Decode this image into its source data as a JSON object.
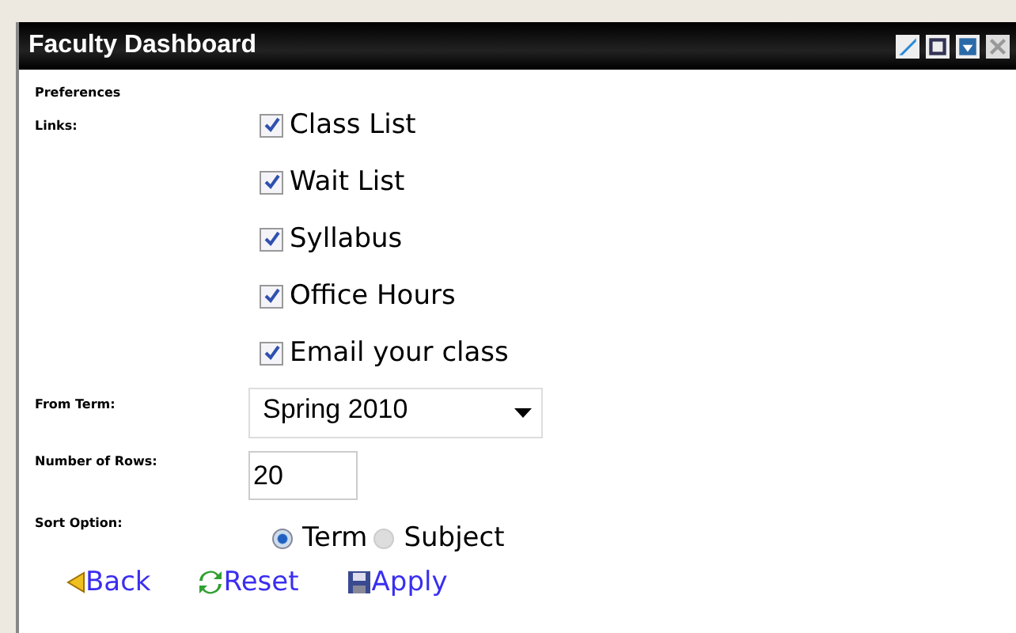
{
  "window": {
    "title": "Faculty Dashboard"
  },
  "section_title": "Preferences",
  "links_label": "Links:",
  "links": [
    {
      "label": "Class List",
      "checked": true
    },
    {
      "label": "Wait List",
      "checked": true
    },
    {
      "label": "Syllabus",
      "checked": true
    },
    {
      "label": "Office Hours",
      "checked": true
    },
    {
      "label": "Email your class",
      "checked": true
    }
  ],
  "from_term": {
    "label": "From Term:",
    "value": "Spring 2010"
  },
  "rows": {
    "label": "Number of Rows:",
    "value": "20"
  },
  "sort": {
    "label": "Sort Option:",
    "options": [
      {
        "label": "Term",
        "selected": true
      },
      {
        "label": "Subject",
        "selected": false
      }
    ]
  },
  "actions": [
    {
      "kind": "back",
      "label": "Back"
    },
    {
      "kind": "reset",
      "label": "Reset"
    },
    {
      "kind": "apply",
      "label": "Apply"
    }
  ]
}
